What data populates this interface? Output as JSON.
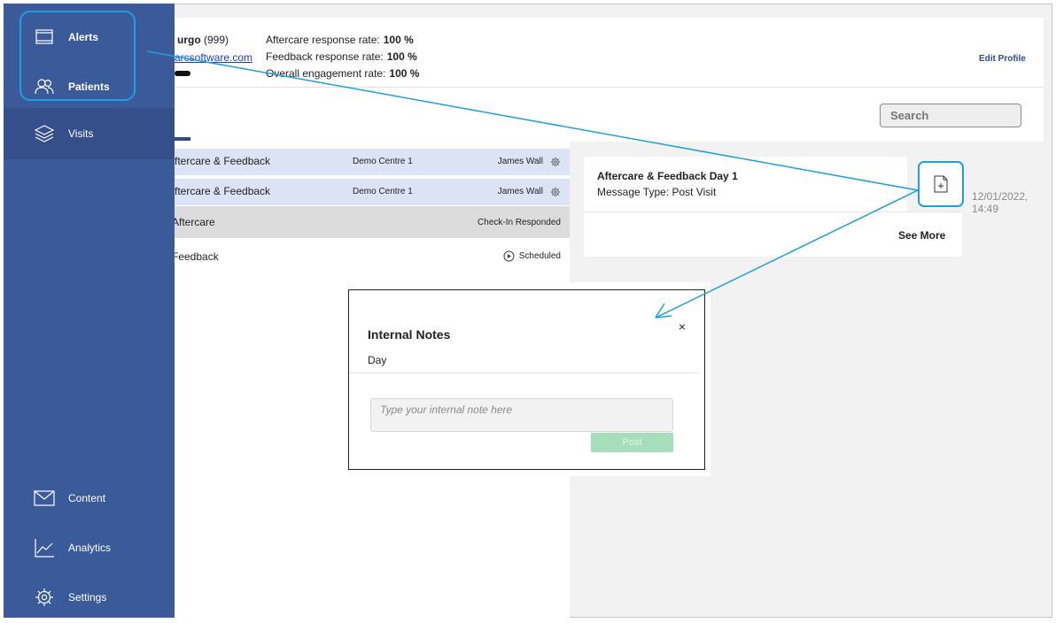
{
  "sidebar": {
    "items": [
      {
        "label": "Alerts",
        "icon": "alerts-icon"
      },
      {
        "label": "Patients",
        "icon": "patients-icon"
      },
      {
        "label": "Visits",
        "icon": "visits-icon"
      },
      {
        "label": "Content",
        "icon": "envelope-icon"
      },
      {
        "label": "Analytics",
        "icon": "analytics-icon"
      },
      {
        "label": "Settings",
        "icon": "gear-icon"
      }
    ]
  },
  "profile": {
    "name": "urgo",
    "id": "(999)",
    "email": "arcsoftware.com",
    "stats": [
      {
        "label": "Aftercare response rate:",
        "value": "100 %"
      },
      {
        "label": "Feedback response rate:",
        "value": "100 %"
      },
      {
        "label": "Overall engagement rate:",
        "value": "100 %"
      }
    ],
    "edit_label": "Edit Profile"
  },
  "search": {
    "placeholder": "Search"
  },
  "list": {
    "rows": [
      {
        "title": "ftercare & Feedback",
        "centre": "Demo Centre 1",
        "staff": "James Wall"
      },
      {
        "title": "ftercare & Feedback",
        "centre": "Demo Centre 1",
        "staff": "James Wall"
      },
      {
        "title": "Aftercare",
        "status": "Check-In Responded"
      },
      {
        "title": "Feedback",
        "status": "Scheduled"
      }
    ]
  },
  "message_card": {
    "title": "Aftercare & Feedback Day 1",
    "type": "Message Type: Post Visit",
    "see_more": "See More",
    "timestamp_date": "12/01/2022,",
    "timestamp_time": "14:49"
  },
  "modal": {
    "title": "Internal Notes",
    "subtitle": "Day",
    "close": "×",
    "placeholder": "Type your internal note here",
    "post_label": "Post"
  },
  "colors": {
    "sidebar": "#3a5a9a",
    "highlight": "#1e9fe0",
    "row_blue": "#dbe3f4",
    "post_button": "#a6ddbb"
  }
}
